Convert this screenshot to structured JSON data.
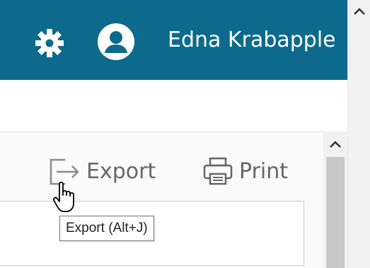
{
  "header": {
    "settings_icon": "gear-icon",
    "user_icon": "user-avatar-icon",
    "user_name": "Edna Krabapple",
    "background_color": "#0d6a8c"
  },
  "toolbar": {
    "export_label": "Export",
    "export_icon": "export-icon",
    "print_label": "Print",
    "print_icon": "printer-icon"
  },
  "tooltip": {
    "text": "Export (Alt+J)"
  },
  "cursor": {
    "type": "hand-pointer-icon"
  }
}
